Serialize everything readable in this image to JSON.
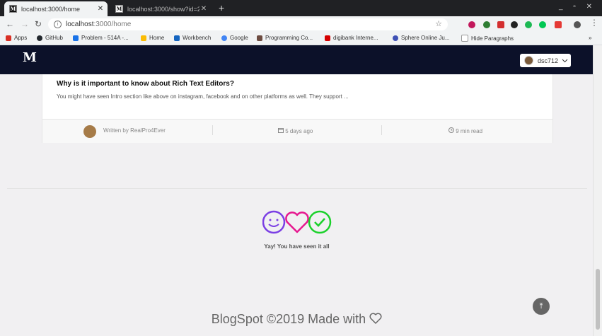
{
  "browser": {
    "tabs": [
      {
        "favicon": "M",
        "title": "localhost:3000/home",
        "close": "✕"
      },
      {
        "favicon": "M",
        "title": "localhost:3000/show?id=26",
        "close": "✕"
      }
    ],
    "new_tab": "+",
    "window_controls": "_ ▫ ✕",
    "url_host": "localhost",
    "url_path": ":3000/home",
    "bookmarks": [
      {
        "label": "Apps",
        "color": "#d93025"
      },
      {
        "label": "GitHub",
        "color": "#24292e"
      },
      {
        "label": "Problem - 514A -...",
        "color": "#1a73e8"
      },
      {
        "label": "Home",
        "color": "#fbbc04"
      },
      {
        "label": "Workbench",
        "color": "#1565c0"
      },
      {
        "label": "Google",
        "color": "#4285f4"
      },
      {
        "label": "Programming Co...",
        "color": "#6d4c41"
      },
      {
        "label": "digibank Interne...",
        "color": "#d50000"
      },
      {
        "label": "Sphere Online Ju...",
        "color": "#3f51b5"
      },
      {
        "label": "Hide Paragraphs",
        "color": "#999999"
      }
    ],
    "more_bookmarks": "»"
  },
  "app": {
    "logo": "M",
    "user": {
      "name": "dsc712",
      "chevron": "chevron-down"
    }
  },
  "article": {
    "title": "Why is it important to know about Rich Text Editors?",
    "excerpt": "You might have seen Intro section like above on instagram, facebook and on other platforms as well. They support ...",
    "author_prefix": "Written by",
    "author": "RealPro4Ever",
    "date": "5 days ago",
    "read_time": "9 min read"
  },
  "end_message": "Yay! You have seen it all",
  "footer": "BlogSpot ©2019 Made with",
  "colors": {
    "nav": "#0c1129",
    "smile": "#7b3fe4",
    "heart": "#e6178f",
    "check": "#1bd12b"
  }
}
